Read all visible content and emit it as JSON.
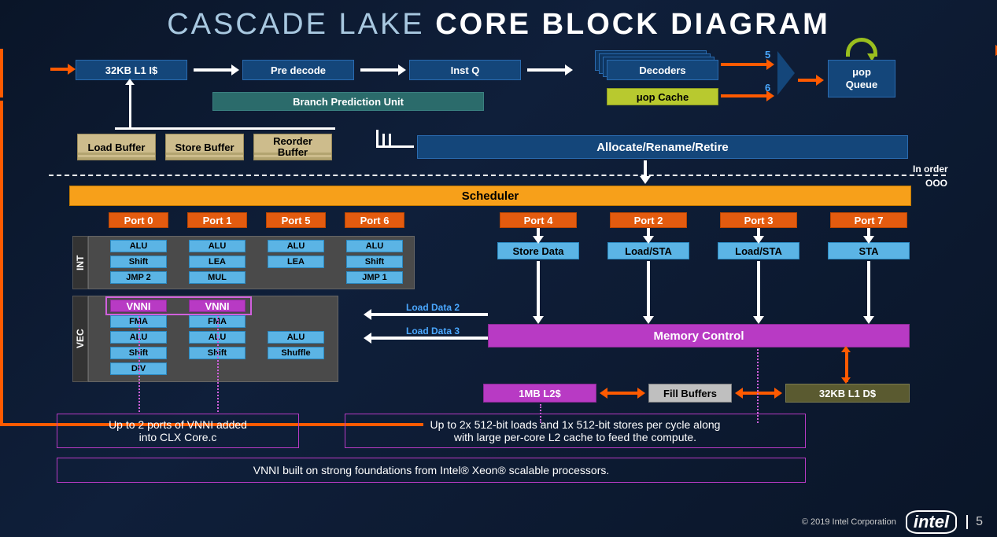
{
  "title_light": "CASCADE LAKE ",
  "title_bold": "CORE BLOCK DIAGRAM",
  "frontend": {
    "l1i": "32KB L1 I$",
    "predecode": "Pre decode",
    "instq": "Inst Q",
    "decoders": "Decoders",
    "uop_cache": "μop Cache",
    "uop_queue": "μop\nQueue",
    "bpu": "Branch Prediction Unit",
    "count5": "5",
    "count6": "6"
  },
  "buffers": {
    "load": "Load Buffer",
    "store": "Store Buffer",
    "reorder": "Reorder\nBuffer"
  },
  "allocate": "Allocate/Rename/Retire",
  "scheduler": "Scheduler",
  "ports": [
    "Port 0",
    "Port 1",
    "Port 5",
    "Port 6",
    "Port 4",
    "Port 2",
    "Port 3",
    "Port 7"
  ],
  "int_ops": {
    "p0": [
      "ALU",
      "Shift",
      "JMP 2"
    ],
    "p1": [
      "ALU",
      "LEA",
      "MUL"
    ],
    "p5": [
      "ALU",
      "LEA"
    ],
    "p6": [
      "ALU",
      "Shift",
      "JMP 1"
    ]
  },
  "vec_ops": {
    "p0": [
      "VNNI",
      "FMA",
      "ALU",
      "Shift",
      "DIV"
    ],
    "p1": [
      "VNNI",
      "FMA",
      "ALU",
      "Shift"
    ],
    "p5": [
      "ALU",
      "Shuffle"
    ]
  },
  "mem_ops": {
    "p4": "Store Data",
    "p2": "Load/STA",
    "p3": "Load/STA",
    "p7": "STA"
  },
  "memctrl": "Memory Control",
  "l2": "1MB L2$",
  "fill": "Fill Buffers",
  "l1d": "32KB L1 D$",
  "labels": {
    "int": "INT",
    "vec": "VEC",
    "inorder": "In order",
    "ooo": "OOO",
    "ld2": "Load Data 2",
    "ld3": "Load Data 3"
  },
  "callouts": {
    "vnni": "Up to 2 ports of VNNI added\ninto CLX Core.c",
    "loads": "Up to 2x 512-bit loads and 1x 512-bit stores per cycle along\nwith large per-core L2 cache to feed the compute.",
    "footer": "VNNI built on strong foundations from Intel® Xeon® scalable processors."
  },
  "copyright": "© 2019 Intel Corporation",
  "brand": "intel",
  "pagenum": "5"
}
